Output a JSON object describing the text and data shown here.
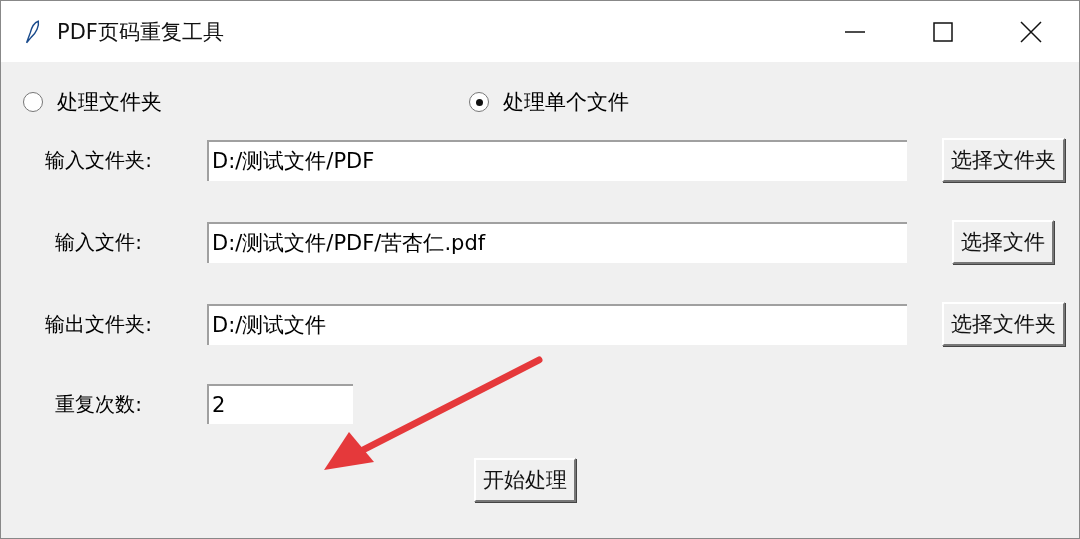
{
  "window": {
    "title": "PDF页码重复工具"
  },
  "modes": [
    {
      "label": "处理文件夹",
      "selected": false
    },
    {
      "label": "处理单个文件",
      "selected": true
    }
  ],
  "rows": [
    {
      "label": "输入文件夹:",
      "value": "D:/测试文件/PDF",
      "button": "选择文件夹"
    },
    {
      "label": "输入文件:",
      "value": "D:/测试文件/PDF/苦杏仁.pdf",
      "button": "选择文件"
    },
    {
      "label": "输出文件夹:",
      "value": "D:/测试文件",
      "button": "选择文件夹"
    }
  ],
  "count": {
    "label": "重复次数:",
    "value": "2"
  },
  "start_button": "开始处理"
}
